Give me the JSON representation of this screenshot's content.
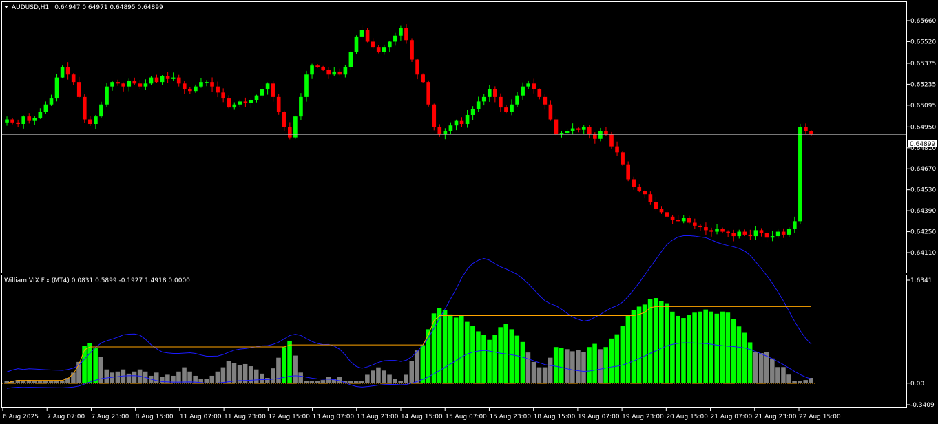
{
  "window": {
    "symbol_title": "AUDUSD,H1",
    "ohlc": "0.64947 0.64971 0.64895 0.64899",
    "indicator_title": "William VIX Fix (MT4) 0.0831 0.5899 -0.1927 1.4918 0.0000"
  },
  "colors": {
    "background": "#000000",
    "grid_border": "#ffffff",
    "bull_candle": "#00ff00",
    "bear_candle": "#ff0000",
    "vix_gray": "#808080",
    "vix_green": "#00ff00",
    "band_blue": "#1a1aff",
    "range_orange": "#ffa500",
    "baseline_orange": "#ffa500"
  },
  "chart_data": [
    {
      "type": "candlestick",
      "title": "AUDUSD,H1",
      "y_ticks": [
        "0.65660",
        "0.65520",
        "0.65375",
        "0.65235",
        "0.65095",
        "0.64950",
        "0.64810",
        "0.64670",
        "0.64530",
        "0.64390",
        "0.64250",
        "0.64110"
      ],
      "current_price": "0.64899",
      "ylim": [
        0.6411,
        0.6566
      ],
      "x_ticks": [
        "6 Aug 2025",
        "7 Aug 07:00",
        "7 Aug 23:00",
        "8 Aug 15:00",
        "11 Aug 07:00",
        "11 Aug 23:00",
        "12 Aug 15:00",
        "13 Aug 07:00",
        "13 Aug 23:00",
        "14 Aug 15:00",
        "15 Aug 07:00",
        "15 Aug 23:00",
        "18 Aug 15:00",
        "19 Aug 07:00",
        "19 Aug 23:00",
        "20 Aug 15:00",
        "21 Aug 07:00",
        "21 Aug 23:00",
        "22 Aug 15:00"
      ],
      "close_path": [
        0.65,
        0.6498,
        0.6497,
        0.6502,
        0.6499,
        0.6501,
        0.6505,
        0.651,
        0.6514,
        0.6528,
        0.6535,
        0.653,
        0.6525,
        0.6515,
        0.65,
        0.6497,
        0.6502,
        0.651,
        0.6522,
        0.6525,
        0.6524,
        0.6522,
        0.6526,
        0.6524,
        0.6522,
        0.6524,
        0.6528,
        0.6525,
        0.6529,
        0.6527,
        0.6528,
        0.6524,
        0.652,
        0.6519,
        0.6522,
        0.6525,
        0.6525,
        0.6522,
        0.6518,
        0.6514,
        0.6508,
        0.651,
        0.6512,
        0.6511,
        0.6513,
        0.6516,
        0.652,
        0.6524,
        0.6515,
        0.6505,
        0.6495,
        0.6488,
        0.6502,
        0.6515,
        0.653,
        0.6536,
        0.6535,
        0.6533,
        0.653,
        0.6532,
        0.653,
        0.6535,
        0.6545,
        0.6555,
        0.656,
        0.6552,
        0.6548,
        0.6545,
        0.6548,
        0.6552,
        0.6556,
        0.6561,
        0.6553,
        0.654,
        0.653,
        0.6525,
        0.651,
        0.6495,
        0.649,
        0.6492,
        0.6496,
        0.6499,
        0.6497,
        0.6503,
        0.6507,
        0.6512,
        0.6515,
        0.652,
        0.6515,
        0.6508,
        0.6505,
        0.651,
        0.6516,
        0.6522,
        0.6524,
        0.652,
        0.6515,
        0.651,
        0.65,
        0.649,
        0.6491,
        0.6492,
        0.6494,
        0.6493,
        0.6495,
        0.649,
        0.6487,
        0.6492,
        0.649,
        0.6482,
        0.6478,
        0.647,
        0.646,
        0.6455,
        0.6452,
        0.645,
        0.6445,
        0.644,
        0.6438,
        0.6435,
        0.6433,
        0.6432,
        0.6434,
        0.6431,
        0.6429,
        0.6428,
        0.6426,
        0.6425,
        0.6427,
        0.6425,
        0.6424,
        0.6422,
        0.6425,
        0.6423,
        0.6422,
        0.6426,
        0.6424,
        0.6421,
        0.6422,
        0.6425,
        0.6423,
        0.6427,
        0.6432,
        0.6495,
        0.6492,
        0.649
      ]
    },
    {
      "type": "bar",
      "title": "William VIX Fix (MT4)",
      "y_ticks": [
        "1.6341",
        "0.00",
        "-0.3409"
      ],
      "ylim": [
        -0.3409,
        1.6341
      ],
      "series": [
        {
          "name": "",
          "color": "#808080"
        },
        {
          "name": "",
          "color": "#00ff00"
        },
        {
          "name": "",
          "color": "#1a1aff"
        },
        {
          "name": "",
          "color": "#ffa500"
        }
      ]
    }
  ]
}
